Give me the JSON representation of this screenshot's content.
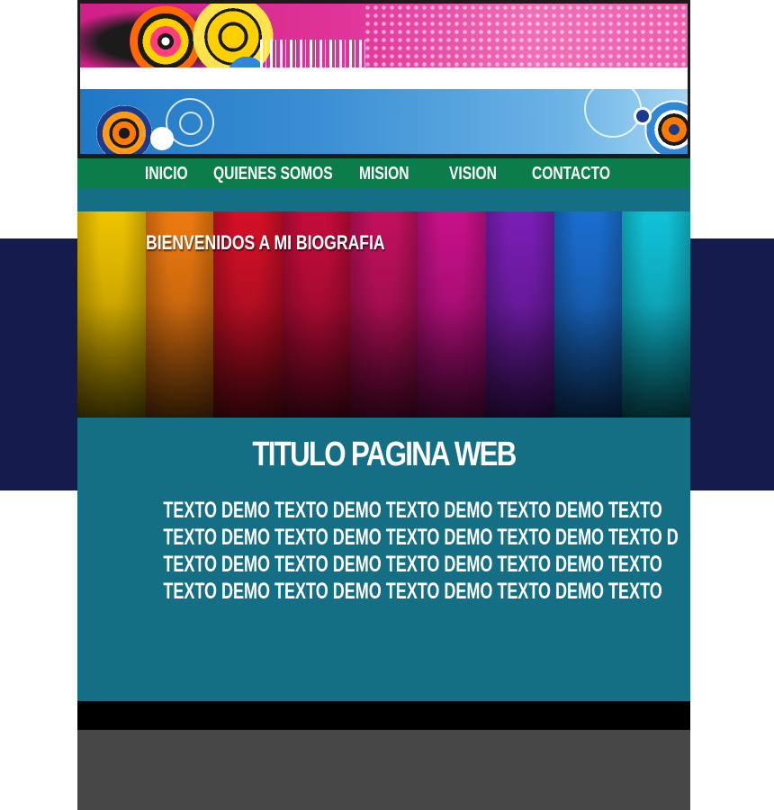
{
  "nav": {
    "items": [
      {
        "label": "INICIO"
      },
      {
        "label": "QUIENES SOMOS"
      },
      {
        "label": "MISION"
      },
      {
        "label": "VISION"
      },
      {
        "label": "CONTACTO"
      }
    ]
  },
  "slider": {
    "title": "BIENVENIDOS A MI BIOGRAFIA",
    "stripe_colors": [
      "#f0c400",
      "#ee7a10",
      "#d41028",
      "#c40c3a",
      "#c2105e",
      "#c8108a",
      "#7a1eb6",
      "#1a6ed0",
      "#10c2d8"
    ]
  },
  "content": {
    "title": "TITULO PAGINA WEB",
    "lines": [
      "TEXTO DEMO  TEXTO DEMO  TEXTO DEMO  TEXTO DEMO  TEXTO",
      "TEXTO DEMO  TEXTO DEMO  TEXTO DEMO  TEXTO DEMO  TEXTO D",
      "TEXTO DEMO  TEXTO DEMO  TEXTO DEMO  TEXTO DEMO  TEXTO",
      "TEXTO DEMO  TEXTO DEMO  TEXTO DEMO  TEXTO DEMO  TEXTO"
    ]
  },
  "colors": {
    "nav_bg": "#0b7d4a",
    "content_bg": "#146e84",
    "side_band": "#141c4d",
    "footer_top": "#000000",
    "footer_bottom": "#474747"
  }
}
